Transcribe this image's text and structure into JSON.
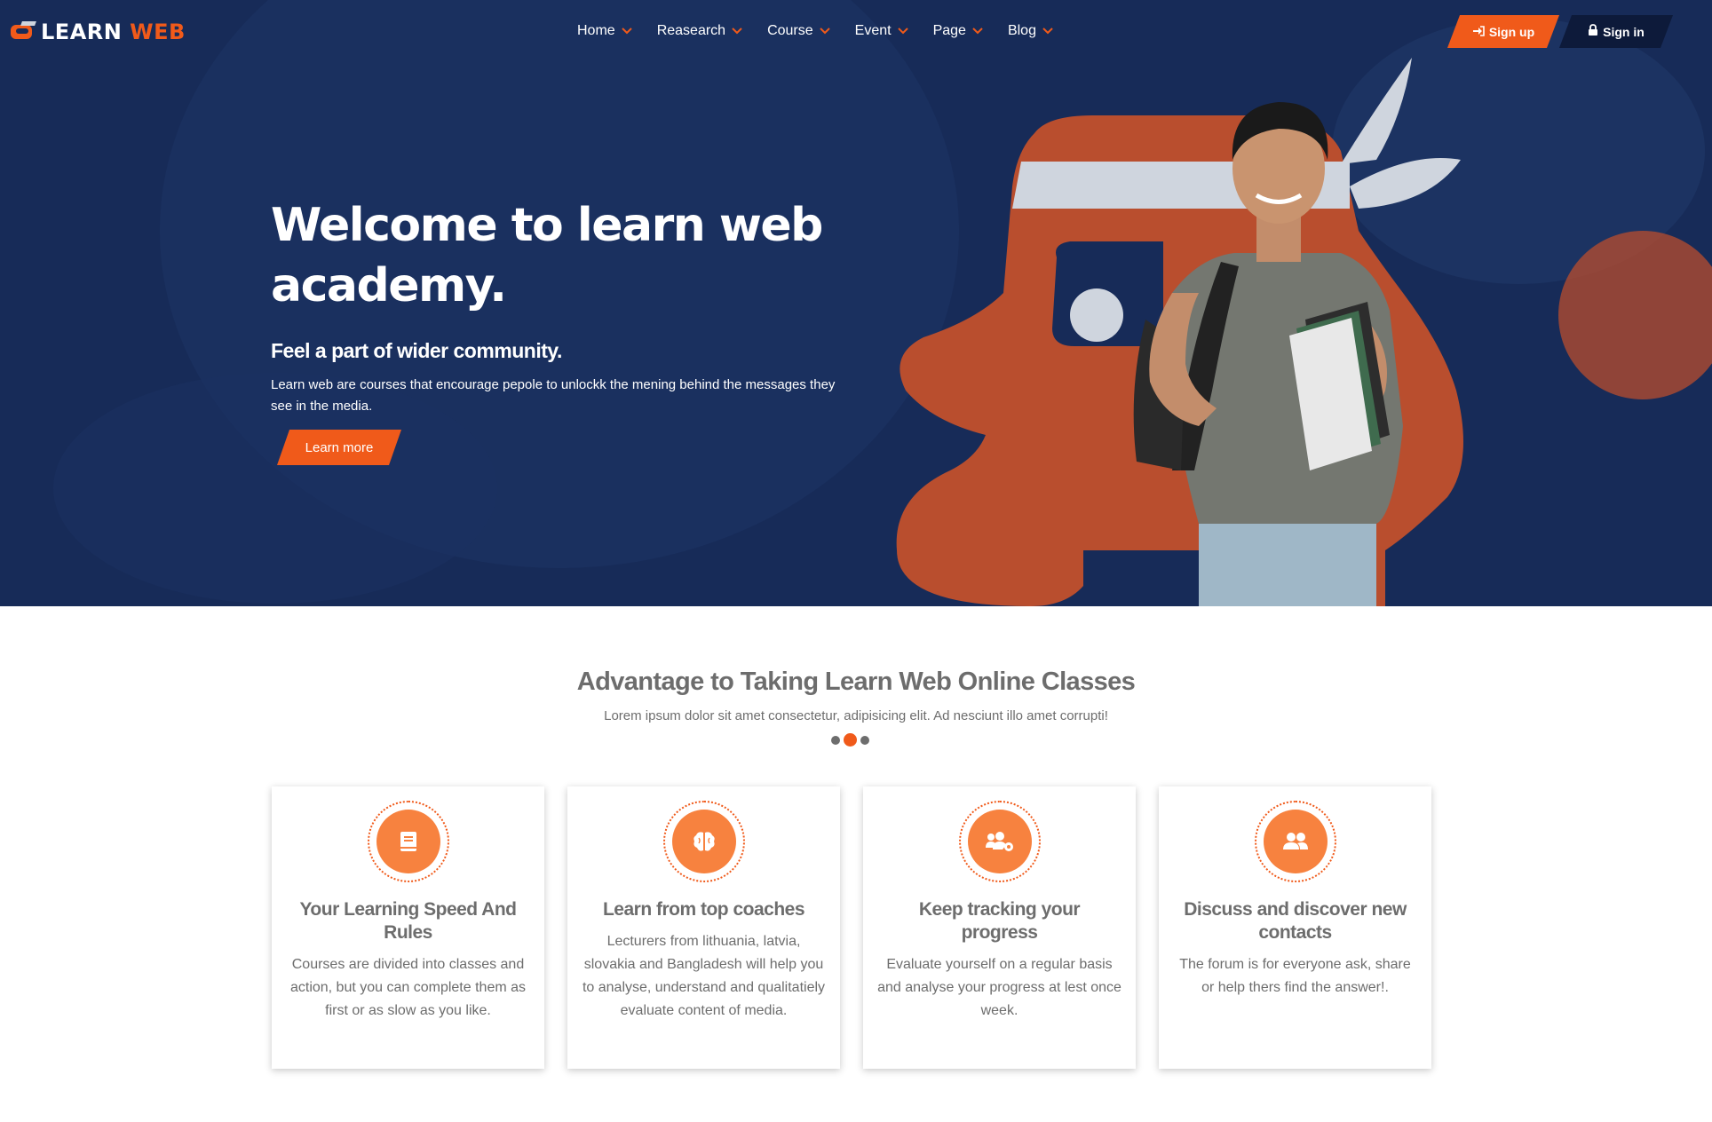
{
  "brand": {
    "logo_white": "LEARN",
    "logo_orange": " WEB",
    "accent_color": "#f05a1a",
    "hero_bg": "#172b58"
  },
  "nav": {
    "items": [
      {
        "label": "Home"
      },
      {
        "label": "Reasearch"
      },
      {
        "label": "Course"
      },
      {
        "label": "Event"
      },
      {
        "label": "Page"
      },
      {
        "label": "Blog"
      }
    ],
    "signup_label": "Sign up",
    "signin_label": "Sign in"
  },
  "hero": {
    "title": "Welcome to learn web academy.",
    "subtitle": "Feel a part of wider community.",
    "body": "Learn web are courses that encourage pepole to unlockk the mening behind the messages they see in the media.",
    "cta_label": "Learn more"
  },
  "advantages": {
    "title": "Advantage to Taking Learn Web Online Classes",
    "subtitle": "Lorem ipsum dolor sit amet consectetur, adipisicing elit. Ad nesciunt illo amet corrupti!",
    "cards": [
      {
        "icon": "book-icon",
        "title": "Your Learning Speed And Rules",
        "body": "Courses are divided into classes and action, but you can complete them as first or as slow as you like."
      },
      {
        "icon": "brain-icon",
        "title": "Learn from top coaches",
        "body": "Lecturers from lithuania, latvia, slovakia and Bangladesh will help you to analyse, understand and qualitatiely evaluate content of media."
      },
      {
        "icon": "users-cog-icon",
        "title": "Keep tracking your progress",
        "body": "Evaluate yourself on a regular basis and analyse your progress at lest once week."
      },
      {
        "icon": "users-icon",
        "title": "Discuss and discover new contacts",
        "body": "The forum is for everyone ask, share or help thers find the answer!."
      }
    ]
  }
}
